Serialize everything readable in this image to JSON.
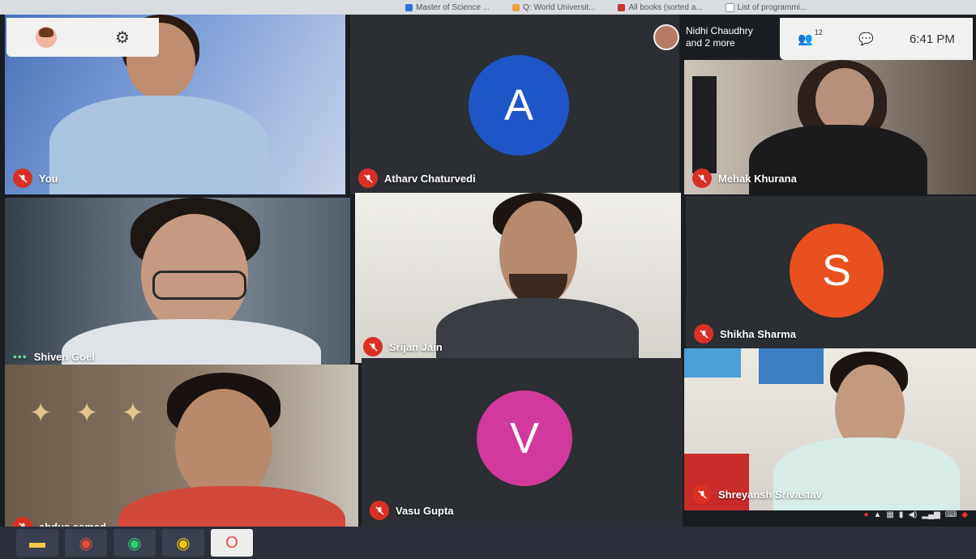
{
  "browser": {
    "bookmarks": [
      {
        "label": "Master of Science ...",
        "color": "#2f6fd6"
      },
      {
        "label": "Q: World Universit...",
        "color": "#e8a33b"
      },
      {
        "label": "All books (sorted a...",
        "color": "#c33"
      },
      {
        "label": "List of programmi...",
        "color": "#fff"
      }
    ]
  },
  "meeting": {
    "presenting": {
      "line1": "Nidhi Chaudhry",
      "line2": "and 2 more"
    },
    "participants_count": "12",
    "chat_icon": "chat-icon",
    "time": "6:41 PM",
    "self_panel_icons": [
      "avatar",
      "gear-icon"
    ]
  },
  "tiles": [
    {
      "name": "You",
      "type": "video",
      "mic_muted": true
    },
    {
      "name": "Atharv Chaturvedi",
      "type": "avatar",
      "initial": "A",
      "color": "#1e56c7",
      "mic_muted": true
    },
    {
      "name": "Mehak Khurana",
      "type": "video",
      "mic_muted": true
    },
    {
      "name": "Shiven Goel",
      "type": "video",
      "mic_muted": false,
      "speaking_dots": "•••"
    },
    {
      "name": "Srijan Jain",
      "type": "video",
      "mic_muted": true
    },
    {
      "name": "Shikha Sharma",
      "type": "avatar",
      "initial": "S",
      "color": "#e8501f",
      "mic_muted": true
    },
    {
      "name": "abdus samad",
      "type": "video",
      "mic_muted": true
    },
    {
      "name": "Vasu Gupta",
      "type": "avatar",
      "initial": "V",
      "color": "#d1399c",
      "mic_muted": true
    },
    {
      "name": "Shreyansh Srivastav",
      "type": "video",
      "mic_muted": true
    }
  ],
  "taskbar": {
    "apps": [
      "file-explorer-icon",
      "chrome-icon",
      "chrome-icon",
      "chrome-icon",
      "opera-icon"
    ]
  }
}
